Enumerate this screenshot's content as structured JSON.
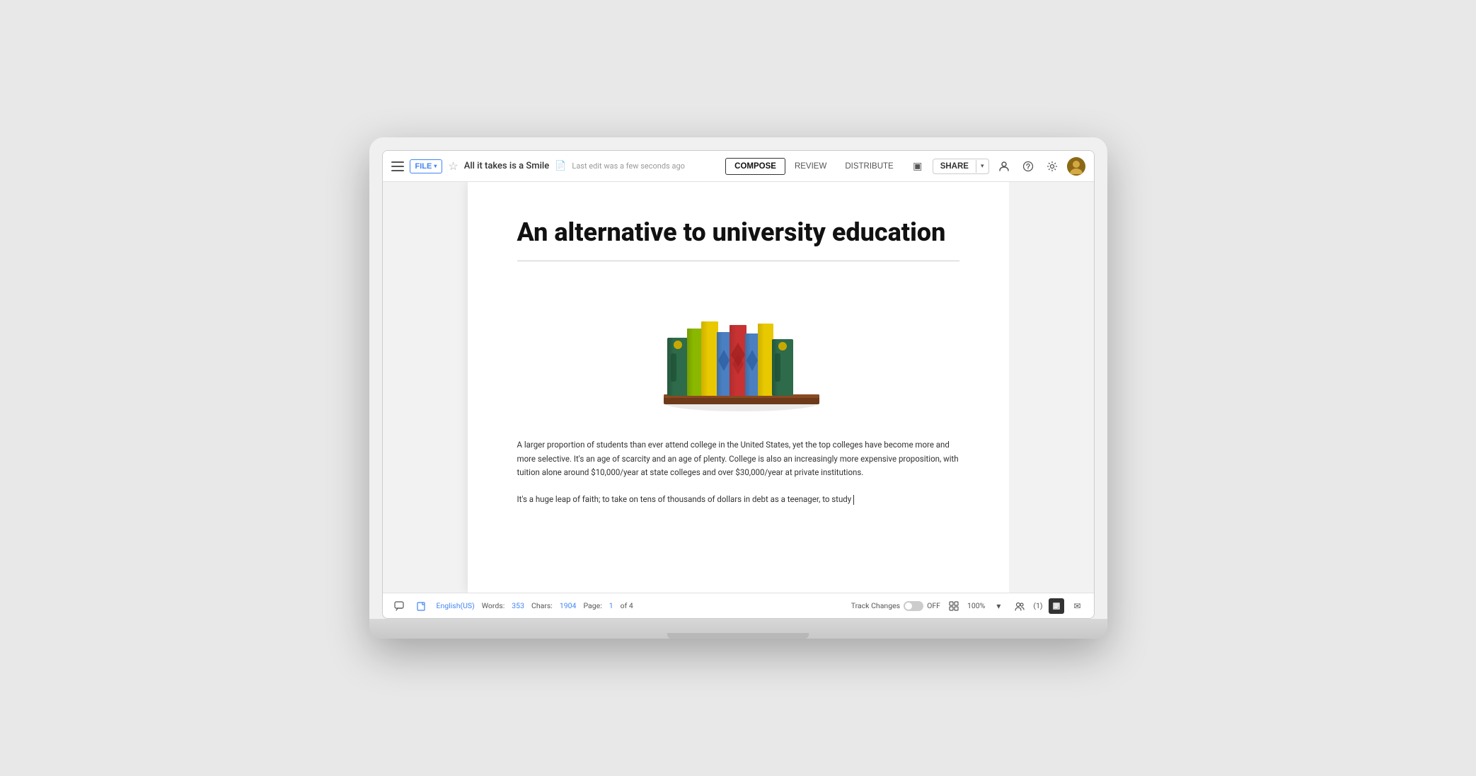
{
  "toolbar": {
    "file_label": "FILE",
    "file_chevron": "▾",
    "doc_title": "All it takes is a Smile",
    "last_edit": "Last edit was a few seconds ago",
    "tabs": [
      {
        "label": "COMPOSE",
        "id": "compose",
        "active": true
      },
      {
        "label": "REVIEW",
        "id": "review",
        "active": false
      },
      {
        "label": "DISTRIBUTE",
        "id": "distribute",
        "active": false
      }
    ],
    "share_label": "SHARE",
    "share_chevron": "▾"
  },
  "document": {
    "heading": "An alternative to university education",
    "paragraph1": "A larger proportion of students than ever attend college in the United States, yet the top colleges have become more and more selective. It's an age of scarcity and an age of plenty. College is also an increasingly more expensive proposition, with tuition alone around $10,000/year at state colleges and over $30,000/year at private institutions.",
    "paragraph2": "It's a huge leap of faith; to take on tens of thousands of dollars in debt as a teenager, to study"
  },
  "statusbar": {
    "language": "English(US)",
    "words_label": "Words:",
    "words_count": "353",
    "chars_label": "Chars:",
    "chars_count": "1904",
    "page_label": "Page:",
    "page_current": "1",
    "page_of": "of 4",
    "track_changes": "Track Changes",
    "track_state": "OFF",
    "zoom": "100%",
    "collab_count": "(1)"
  },
  "icons": {
    "hamburger": "☰",
    "star": "☆",
    "doc_file": "📄",
    "comment": "💬",
    "file_convert": "↔",
    "search_user": "👤",
    "help": "?",
    "settings": "⚙",
    "presentation": "▣",
    "grid": "⊞",
    "email": "✉",
    "zoom_controls": "⊕",
    "users_icon": "👥"
  }
}
